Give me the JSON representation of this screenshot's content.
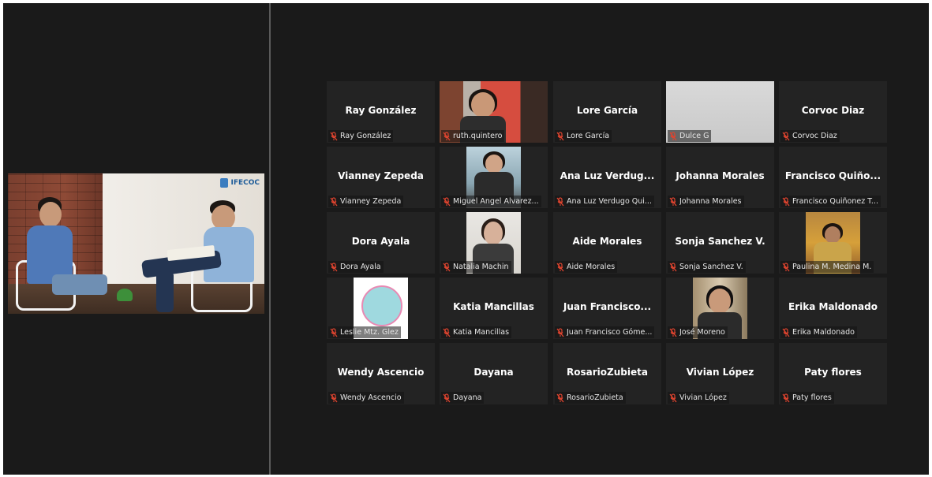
{
  "shared_video": {
    "logo_text": "IFECOC"
  },
  "colors": {
    "background": "#1a1a1a",
    "tile": "#232323",
    "muted_mic": "#e0442f",
    "text": "#ffffff"
  },
  "participants": [
    {
      "display": "Ray González",
      "tag": "Ray González"
    },
    {
      "display": "",
      "tag": "ruth.quintero"
    },
    {
      "display": "Lore García",
      "tag": "Lore García"
    },
    {
      "display": "",
      "tag": "Dulce G"
    },
    {
      "display": "Corvoc Diaz",
      "tag": "Corvoc Diaz"
    },
    {
      "display": "Vianney Zepeda",
      "tag": "Vianney Zepeda"
    },
    {
      "display": "",
      "tag": "Miguel Angel Alvarez..."
    },
    {
      "display": "Ana Luz Verdug...",
      "tag": "Ana Luz Verdugo Qui..."
    },
    {
      "display": "Johanna Morales",
      "tag": "Johanna Morales"
    },
    {
      "display": "Francisco Quiño...",
      "tag": "Francisco Quiñonez T..."
    },
    {
      "display": "Dora Ayala",
      "tag": "Dora Ayala"
    },
    {
      "display": "",
      "tag": "Natalia Machin"
    },
    {
      "display": "Aide Morales",
      "tag": "Aide Morales"
    },
    {
      "display": "Sonja Sanchez V.",
      "tag": "Sonja Sanchez V."
    },
    {
      "display": "",
      "tag": "Paulina M. Medina M."
    },
    {
      "display": "",
      "tag": "Leslie Mtz. Glez"
    },
    {
      "display": "Katia Mancillas",
      "tag": "Katia Mancillas"
    },
    {
      "display": "Juan Francisco...",
      "tag": "Juan Francisco Góme..."
    },
    {
      "display": "",
      "tag": "José Moreno"
    },
    {
      "display": "Erika Maldonado",
      "tag": "Erika Maldonado"
    },
    {
      "display": "Wendy Ascencio",
      "tag": "Wendy Ascencio"
    },
    {
      "display": "Dayana",
      "tag": "Dayana"
    },
    {
      "display": "RosarioZubieta",
      "tag": "RosarioZubieta"
    },
    {
      "display": "Vivian López",
      "tag": "Vivian López"
    },
    {
      "display": "Paty flores",
      "tag": "Paty flores"
    }
  ]
}
